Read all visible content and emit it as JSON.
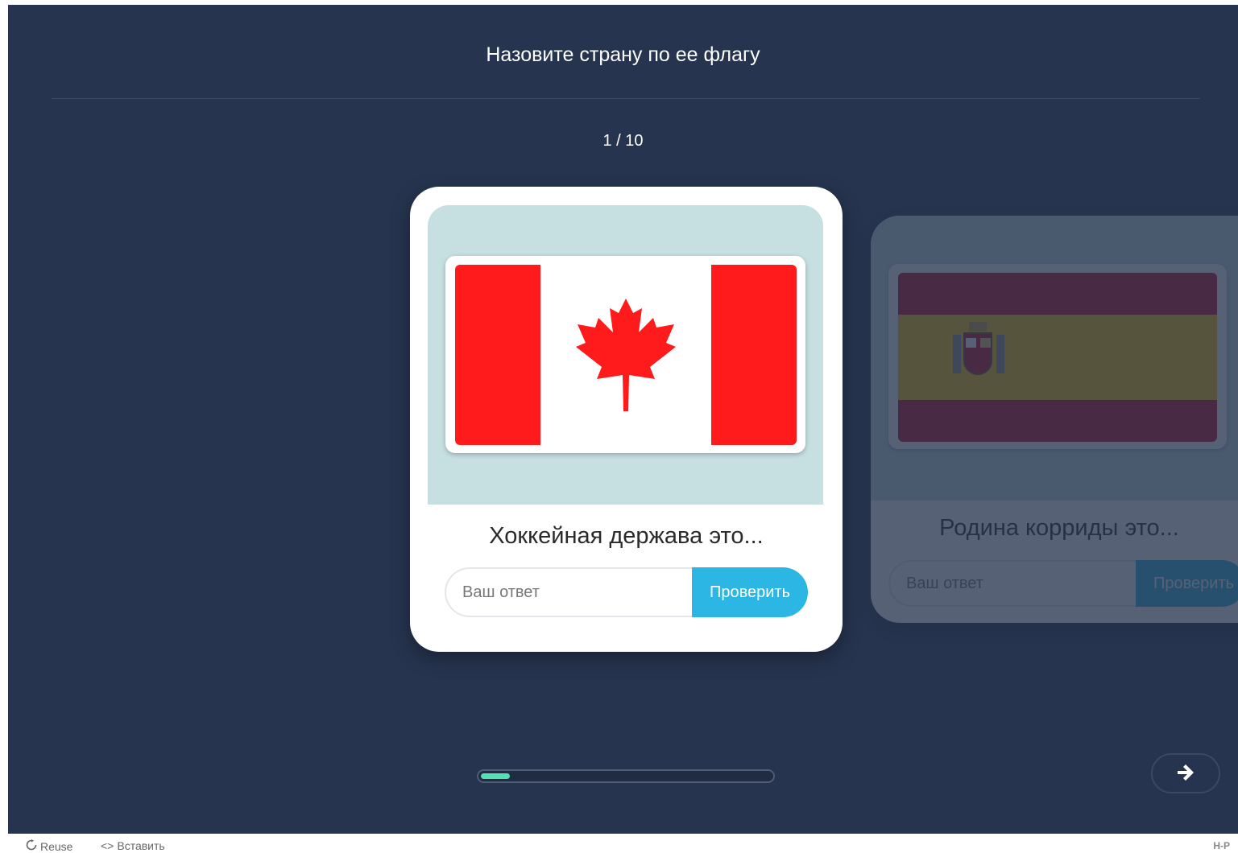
{
  "header": {
    "title": "Назовите страну по ее флагу",
    "counter": "1 / 10"
  },
  "cards": [
    {
      "question": "Хоккейная держава это...",
      "flag": "canada-flag",
      "answer": {
        "placeholder": "Ваш ответ",
        "value": ""
      },
      "check_label": "Проверить"
    },
    {
      "question": "Родина корриды это...",
      "flag": "spain-flag",
      "answer": {
        "placeholder": "Ваш ответ",
        "value": ""
      },
      "check_label": "Проверить"
    }
  ],
  "progress": {
    "fraction": 0.1
  },
  "nav": {
    "next_icon": "arrow-right-icon"
  },
  "footer": {
    "reuse_label": "Reuse",
    "embed_label": "Вставить",
    "badge": "H-P"
  },
  "colors": {
    "background": "#26344f",
    "accent": "#2cb6e3",
    "progress": "#55e0b1",
    "canada_red": "#ff1b1b",
    "spain_red": "#c60b1e",
    "spain_yellow": "#ffc400"
  }
}
